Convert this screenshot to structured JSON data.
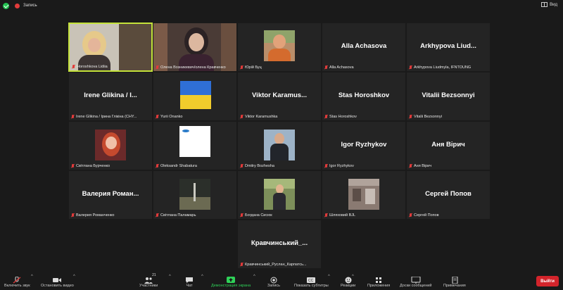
{
  "topbar": {
    "rec_label": "Запись",
    "view_label": "Вид"
  },
  "tiles": [
    {
      "caption": "Horoshkova Lidiia",
      "big_name": ""
    },
    {
      "caption": "Олена Возникевич/олена Кравченко",
      "big_name": ""
    },
    {
      "caption": "Юрій Буц",
      "big_name": ""
    },
    {
      "caption": "Alla Achasova",
      "big_name": "Alla Achasova"
    },
    {
      "caption": "Arkhypova Liudmyla, IFNTOUNG",
      "big_name": "Arkhypova Liud..."
    },
    {
      "caption": "Irene Glikina / Ірина Глікіна (CHY...",
      "big_name": "Irene Glikina / I..."
    },
    {
      "caption": "Yurii Onanko",
      "big_name": ""
    },
    {
      "caption": "Viktor Karamushka",
      "big_name": "Viktor Karamus..."
    },
    {
      "caption": "Stas Horoshkov",
      "big_name": "Stas Horoshkov"
    },
    {
      "caption": "Vitalii Bezsonnyi",
      "big_name": "Vitalii Bezsonnyi"
    },
    {
      "caption": "Світлана Бурченко",
      "big_name": ""
    },
    {
      "caption": "Oleksandr Shabatura",
      "big_name": ""
    },
    {
      "caption": "Dmitry Bozhesha",
      "big_name": ""
    },
    {
      "caption": "Igor Ryzhykov",
      "big_name": "Igor Ryzhykov"
    },
    {
      "caption": "Аня Вірич",
      "big_name": "Аня Вірич"
    },
    {
      "caption": "Валерия Романченко",
      "big_name": "Валерия Роман..."
    },
    {
      "caption": "Світлана Паламарь",
      "big_name": ""
    },
    {
      "caption": "Богдана Сисюк",
      "big_name": ""
    },
    {
      "caption": "Шляховий BJL",
      "big_name": ""
    },
    {
      "caption": "Сергей Попов",
      "big_name": "Сергей Попов"
    },
    {
      "caption": "Кравчинський_Руслан_Карпатсь...",
      "big_name": "Кравчинський_..."
    }
  ],
  "toolbar": {
    "audio": "Включить звук",
    "video": "Остановить видео",
    "participants": "Участники",
    "participants_count": "21",
    "chat": "Чат",
    "share": "Демонстрация экрана",
    "record": "Запись",
    "subtitles": "Показать субтитры",
    "reactions": "Реакции",
    "apps": "Приложения",
    "whiteboard": "Доски сообщений",
    "notes": "Примечания",
    "exit": "Выйти"
  },
  "colors": {
    "active_speaker": "#c4e23a",
    "share_green": "#2fd158",
    "exit_red": "#d3242b",
    "muted_red": "#e23b3b"
  }
}
